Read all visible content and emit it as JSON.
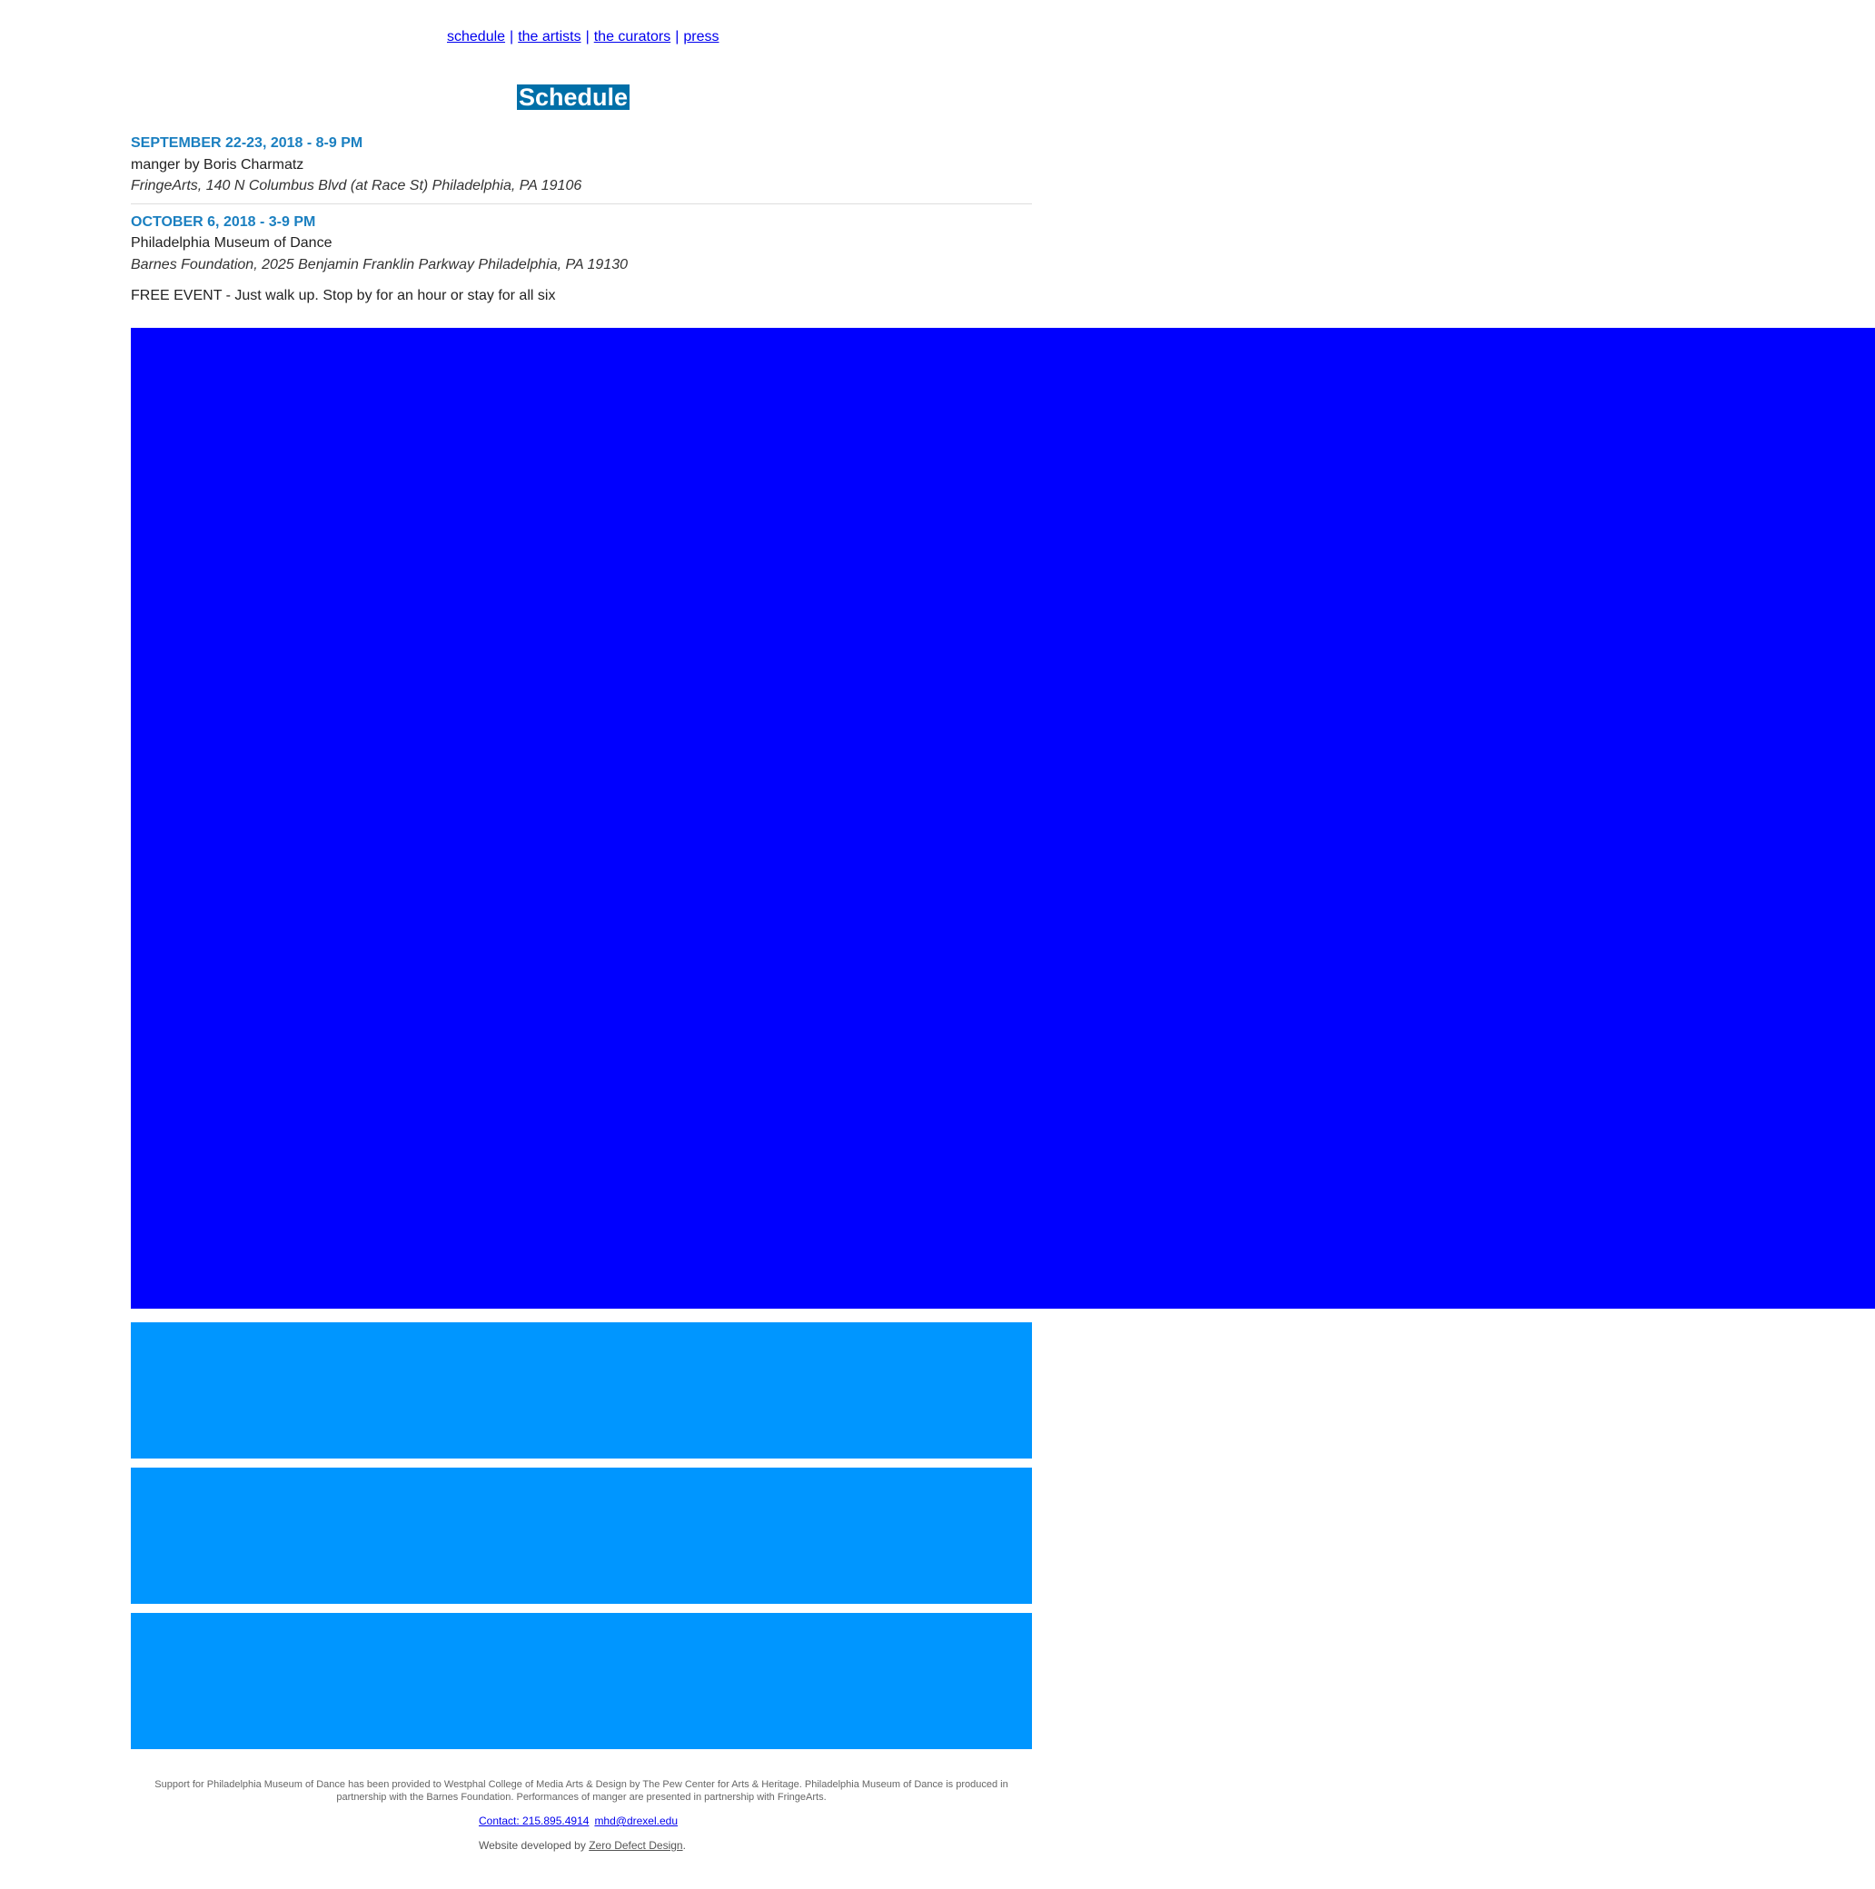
{
  "nav": {
    "items": [
      {
        "label": "schedule"
      },
      {
        "label": "the artists"
      },
      {
        "label": "the curators"
      },
      {
        "label": "press"
      }
    ],
    "separator": "|"
  },
  "page_title": "Schedule",
  "events": [
    {
      "date": "SEPTEMBER 22-23, 2018 - 8-9 PM",
      "name": "manger by Boris Charmatz",
      "venue": "FringeArts, 140 N Columbus Blvd (at Race St) Philadelphia, PA 19106"
    },
    {
      "date": "OCTOBER 6, 2018 - 3-9 PM",
      "name": "Philadelphia Museum of Dance",
      "venue": "Barnes Foundation, 2025 Benjamin Franklin Parkway Philadelphia, PA 19130",
      "note": "FREE EVENT - Just walk up. Stop by for an hour or stay for all six"
    }
  ],
  "colors": {
    "video_placeholder": "#0000ff",
    "gallery_placeholder": "#0096ff",
    "title_bg": "#006fa8",
    "date_color": "#1a7fc0"
  },
  "footer": {
    "support_text": "Support for Philadelphia Museum of Dance has been provided to Westphal College of Media Arts & Design by The Pew Center for Arts & Heritage. Philadelphia Museum of Dance is produced in partnership with the Barnes Foundation. Performances of manger are presented in partnership with FringeArts.",
    "contact_label": "Contact: 215.895.4914",
    "email": "mhd@drexel.edu",
    "credit_prefix": "Website developed by",
    "credit_link": "Zero Defect Design",
    "credit_suffix": "."
  }
}
